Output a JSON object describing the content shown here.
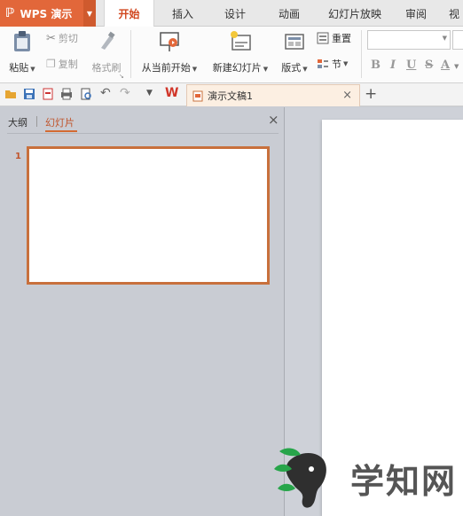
{
  "app": {
    "name": "WPS 演示"
  },
  "tabs": [
    {
      "label": "开始",
      "active": true
    },
    {
      "label": "插入"
    },
    {
      "label": "设计"
    },
    {
      "label": "动画"
    },
    {
      "label": "幻灯片放映"
    },
    {
      "label": "审阅"
    },
    {
      "label": "视"
    }
  ],
  "ribbon": {
    "paste": "粘贴",
    "cut": "剪切",
    "copy": "复制",
    "format_painter": "格式刷",
    "from_current": "从当前开始",
    "new_slide": "新建幻灯片",
    "layout": "版式",
    "reset": "重置",
    "section": "节",
    "bold": "B",
    "italic": "I",
    "underline": "U",
    "strike": "S",
    "font_color": "A"
  },
  "quickbar": {
    "document_tab": "演示文稿1",
    "close": "×",
    "new_tab": "+"
  },
  "left_pane": {
    "tab_outline": "大纲",
    "tab_slides": "幻灯片",
    "close": "×",
    "slides": [
      {
        "number": "1"
      }
    ]
  },
  "watermark": {
    "text": "学知网"
  },
  "colors": {
    "accent": "#e2673a",
    "thumb_border": "#c8703c"
  }
}
